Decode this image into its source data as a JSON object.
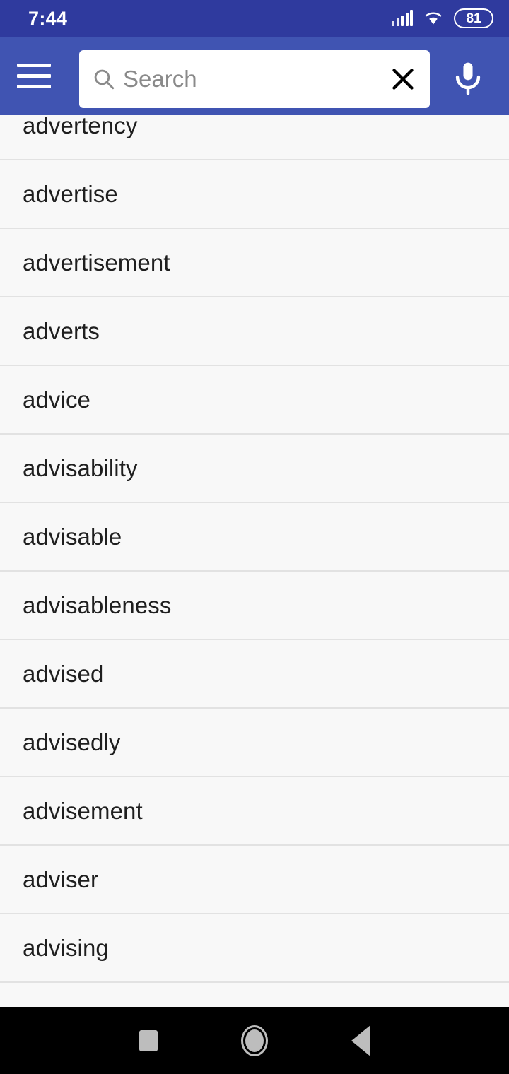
{
  "status_bar": {
    "time": "7:44",
    "signal_icon": "cellular-signal-icon",
    "wifi_icon": "wifi-icon",
    "battery_level": "81",
    "background_color": "#2f3a9e"
  },
  "app_bar": {
    "background_color": "#4054b2",
    "menu_icon": "hamburger-menu-icon",
    "search": {
      "value": "",
      "placeholder": "Search",
      "search_icon": "search-icon",
      "clear_icon": "close-icon"
    },
    "mic_icon": "microphone-icon"
  },
  "word_list": {
    "background_color": "#f8f8f8",
    "items": [
      {
        "label": "advertency"
      },
      {
        "label": "advertise"
      },
      {
        "label": "advertisement"
      },
      {
        "label": "adverts"
      },
      {
        "label": "advice"
      },
      {
        "label": "advisability"
      },
      {
        "label": "advisable"
      },
      {
        "label": "advisableness"
      },
      {
        "label": "advised"
      },
      {
        "label": "advisedly"
      },
      {
        "label": "advisement"
      },
      {
        "label": "adviser"
      },
      {
        "label": "advising"
      },
      {
        "label": ""
      }
    ]
  },
  "nav_bar": {
    "background_color": "#000000",
    "buttons": [
      {
        "name": "recents-button",
        "icon": "square-icon"
      },
      {
        "name": "home-button",
        "icon": "circle-icon"
      },
      {
        "name": "back-button",
        "icon": "triangle-left-icon"
      }
    ]
  }
}
